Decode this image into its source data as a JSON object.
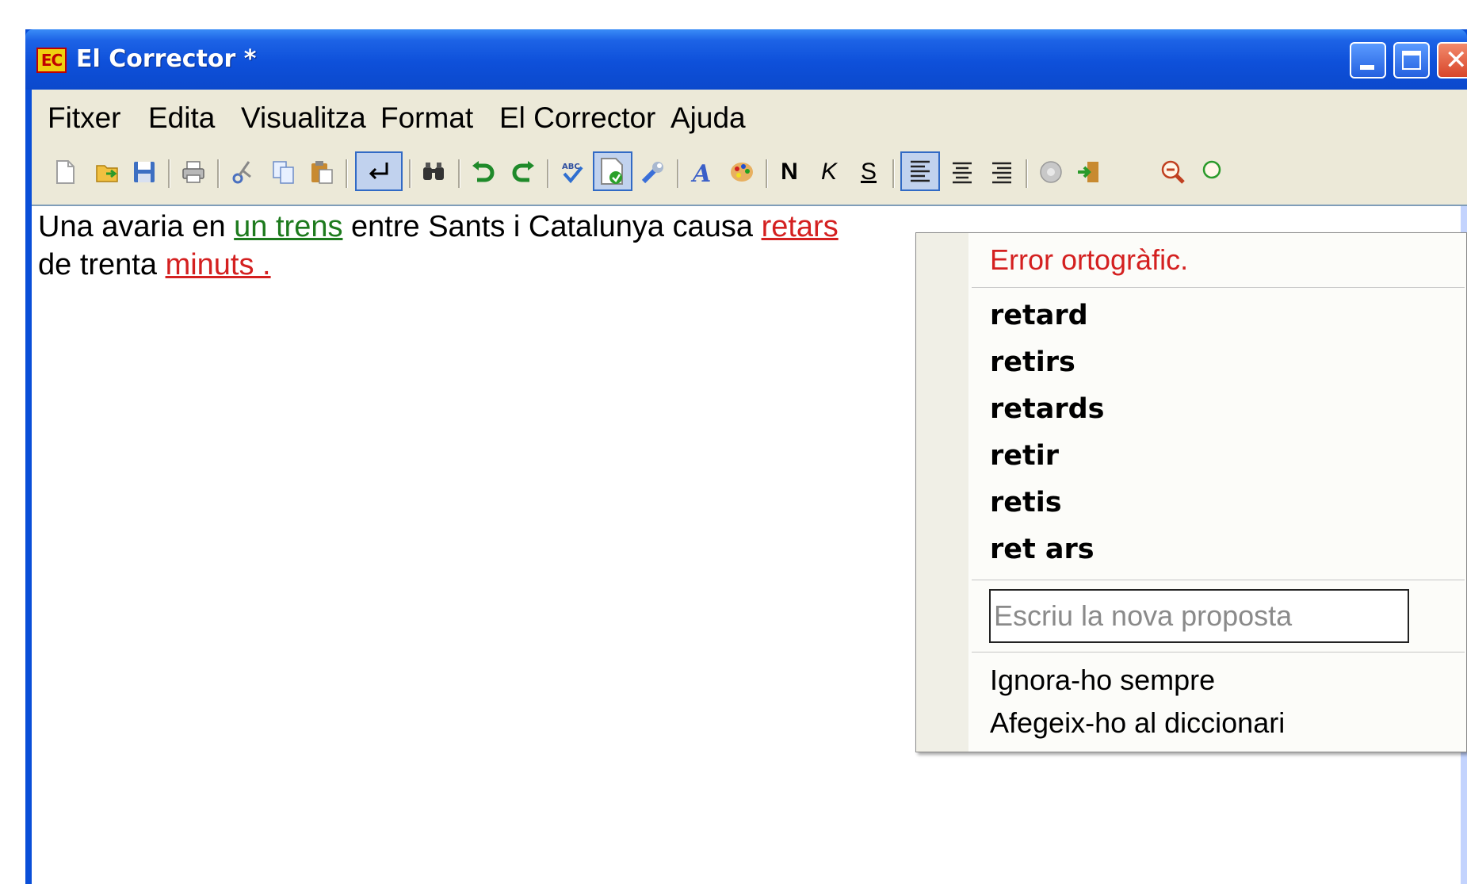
{
  "window": {
    "app_icon_text": "EC",
    "title": "El Corrector *"
  },
  "menu": [
    "Fitxer",
    "Edita",
    "Visualitza",
    "Format",
    "El Corrector",
    "Ajuda"
  ],
  "toolbar": {
    "icons": [
      "new-document-icon",
      "open-folder-icon",
      "save-icon",
      "print-icon",
      "cut-icon",
      "copy-icon",
      "paste-icon",
      "line-break-icon",
      "find-icon",
      "undo-icon",
      "redo-icon",
      "spellcheck-icon",
      "check-document-icon",
      "settings-wrench-icon",
      "font-icon",
      "color-palette-icon",
      "align-left-icon",
      "align-center-icon",
      "align-right-icon",
      "info-icon",
      "exit-icon",
      "zoom-out-icon",
      "zoom-in-icon"
    ],
    "bold_label": "N",
    "italic_label": "K",
    "underline_label": "S"
  },
  "editor": {
    "line1": {
      "before": "Una avaria en ",
      "grammar_error": "un trens",
      "middle": " entre Sants i Catalunya causa ",
      "spelling_error": "retars"
    },
    "line2": {
      "before": "de trenta ",
      "spelling_error": "minuts ."
    }
  },
  "context_menu": {
    "header": "Error ortogràfic.",
    "suggestions": [
      "retard",
      "retirs",
      "retards",
      "retir",
      "retis",
      "ret ars"
    ],
    "input_placeholder": "Escriu la nova proposta",
    "actions": [
      "Ignora-ho sempre",
      "Afegeix-ho al diccionari"
    ]
  },
  "colors": {
    "title_bar": "#0b49cc",
    "grammar_error": "#1d7a1d",
    "spelling_error": "#d42020"
  }
}
